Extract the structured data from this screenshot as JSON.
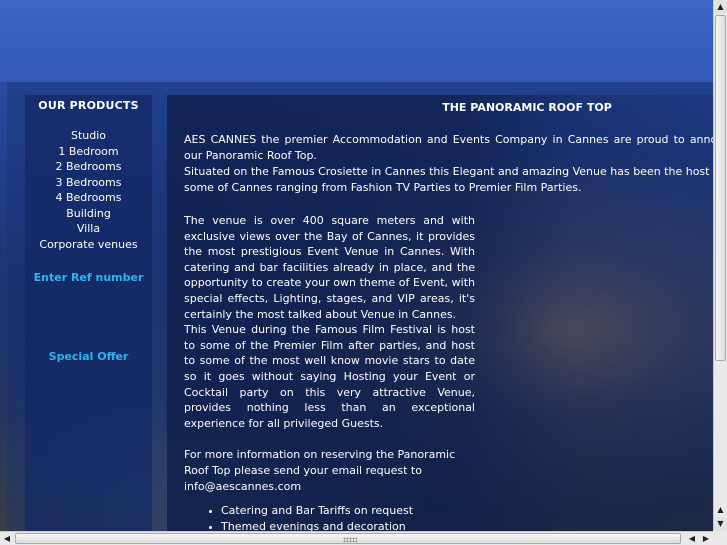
{
  "sidebar": {
    "heading": "OUR PRODUCTS",
    "items": [
      {
        "label": "Studio"
      },
      {
        "label": "1 Bedroom"
      },
      {
        "label": "2 Bedrooms"
      },
      {
        "label": "3 Bedrooms"
      },
      {
        "label": "4 Bedrooms"
      },
      {
        "label": "Building"
      },
      {
        "label": "Villa"
      },
      {
        "label": "Corporate venues"
      }
    ],
    "ref_link": "Enter Ref number",
    "special_link": "Special Offer"
  },
  "main": {
    "title": "THE PANORAMIC ROOF TOP",
    "intro_1": "AES CANNES the premier Accommodation and Events Company in Cannes are proud to announce our Panoramic Roof Top.",
    "intro_2": "Situated on the Famous Crosiette in Cannes this Elegant and amazing Venue has been the host of some of Cannes ranging from Fashion TV Parties to Premier Film Parties.",
    "para_1": "The venue is over 400 square meters and with exclusive views over the Bay of Cannes, it provides the most prestigious Event Venue in Cannes. With catering and bar facilities already in place, and the opportunity to create your own theme of Event, with special effects, Lighting, stages, and VIP areas, it's certainly the most talked about Venue in Cannes.",
    "para_2": "This Venue during the Famous Film Festival is host to some of the Premier Film after parties, and host to some of the most well know movie stars to date so it goes without saying Hosting your Event or Cocktail party on this very attractive Venue, provides nothing less than an exceptional experience for all privileged Guests.",
    "para_3": "For more information on reserving the Panoramic Roof Top please send your email request to info@aescannes.com",
    "bullets": [
      {
        "text": "Catering and Bar Tariffs on request"
      },
      {
        "text": "Themed evenings and decoration requirements available"
      }
    ]
  },
  "colors": {
    "link": "#2bb5f0",
    "panel": "#122864",
    "text": "#ffffff"
  },
  "icons": {
    "scroll_up": "arrow-up-icon",
    "scroll_down": "arrow-down-icon",
    "scroll_left": "arrow-left-icon",
    "scroll_right": "arrow-right-icon"
  }
}
